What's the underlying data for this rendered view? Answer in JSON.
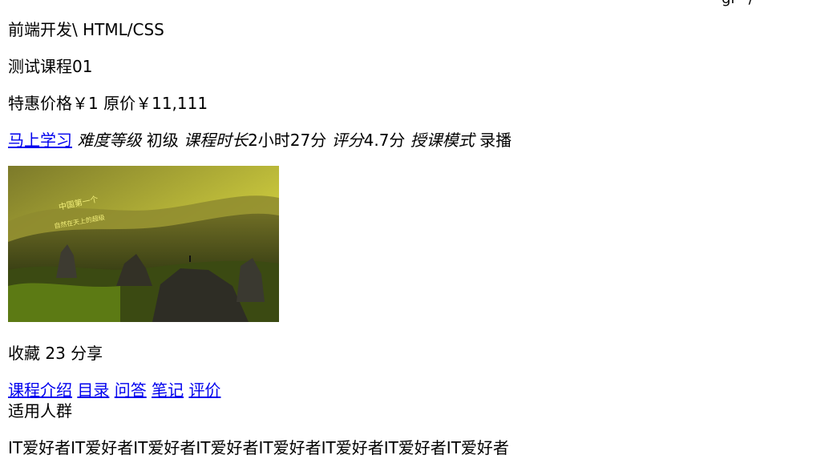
{
  "breadcrumb": "前端开发\\ HTML/CSS",
  "course": {
    "title": "测试课程01",
    "price_label": "特惠价格",
    "price_value": "￥1",
    "orig_label": "原价",
    "orig_value": "￥11,111"
  },
  "meta": {
    "start_link": "马上学习",
    "difficulty_label": "难度等级",
    "difficulty_value": "初级",
    "duration_label": "课程时长",
    "duration_value": "2小时27分",
    "rating_label": "评分",
    "rating_value": "4.7分",
    "mode_label": "授课模式",
    "mode_value": "录播"
  },
  "hero": {
    "overlay_line1": "中国第一个",
    "overlay_line2": "自然在天上的超级"
  },
  "actions": {
    "favorite_label": "收藏",
    "favorite_count": "23",
    "share_label": "分享"
  },
  "tabs": [
    "课程介绍",
    "目录",
    "问答",
    "笔记",
    "评价"
  ],
  "audience": {
    "heading": "适用人群",
    "text": "IT爱好者IT爱好者IT爱好者IT爱好者IT爱好者IT爱好者IT爱好者IT爱好者"
  },
  "colors": {
    "link": "#0000ee",
    "sky_top": "#b8b83a",
    "hill_dark": "#2f3a12",
    "rock": "#3a3a2f"
  }
}
